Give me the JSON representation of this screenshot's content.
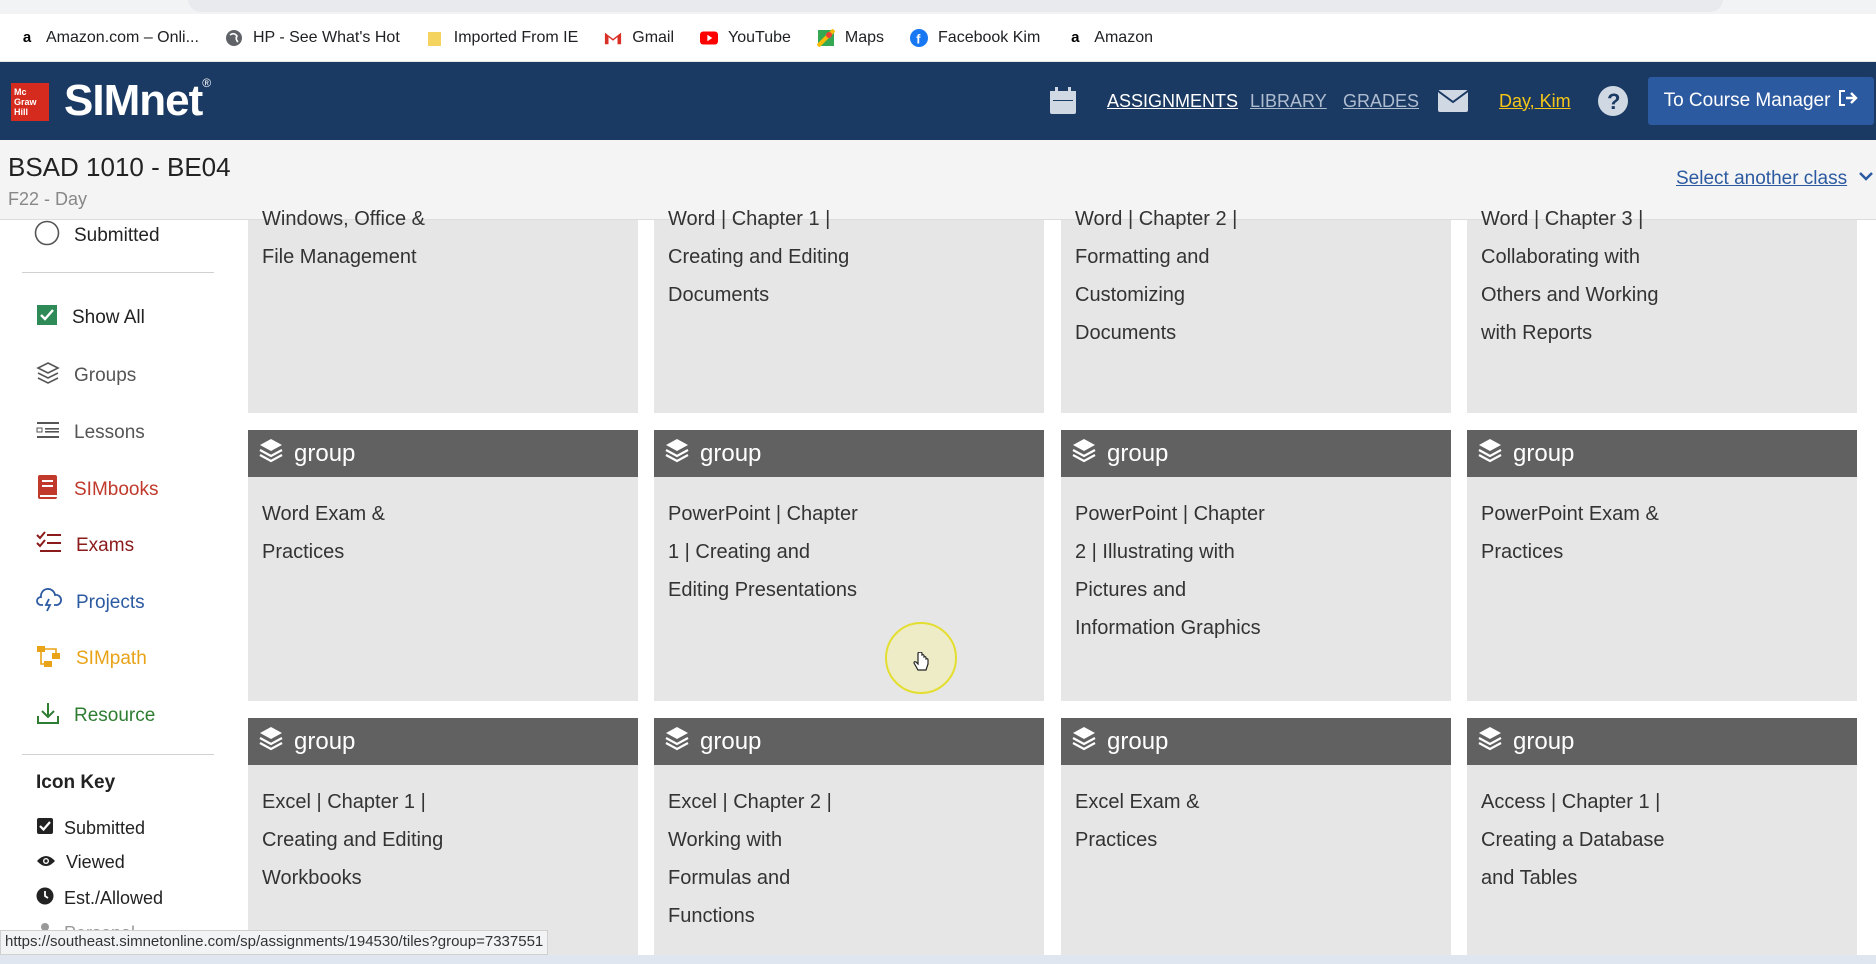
{
  "browser": {
    "url": "southeast.simnetonline.com/sp/assignments/194530/tiles?group=7337543",
    "bookmarks": [
      {
        "label": "Amazon.com – Onli...",
        "icon": "amazon-icon"
      },
      {
        "label": "HP - See What's Hot",
        "icon": "globe-icon"
      },
      {
        "label": "Imported From IE",
        "icon": "folder-icon"
      },
      {
        "label": "Gmail",
        "icon": "gmail-icon"
      },
      {
        "label": "YouTube",
        "icon": "youtube-icon"
      },
      {
        "label": "Maps",
        "icon": "maps-icon"
      },
      {
        "label": "Facebook Kim",
        "icon": "facebook-icon"
      },
      {
        "label": "Amazon",
        "icon": "amazon-icon"
      }
    ]
  },
  "header": {
    "logo_text": "SIMnet",
    "logo_sup": "®",
    "mcgraw": "Mc\nGraw\nHill",
    "nav": {
      "assignments": "ASSIGNMENTS",
      "library": "LIBRARY",
      "grades": "GRADES",
      "user": "Day, Kim"
    },
    "course_manager": "To Course Manager"
  },
  "classbar": {
    "title": "BSAD 1010 - BE04",
    "subtitle": "F22 - Day",
    "select_link": "Select another class"
  },
  "sidebar": {
    "submitted_radio": "Submitted",
    "show_all": "Show All",
    "items": [
      {
        "label": "Groups",
        "color": "#555555",
        "icon": "layers-icon"
      },
      {
        "label": "Lessons",
        "color": "#555555",
        "icon": "lessons-icon"
      },
      {
        "label": "SIMbooks",
        "color": "#c0392b",
        "icon": "book-icon"
      },
      {
        "label": "Exams",
        "color": "#8b1a1a",
        "icon": "exam-list-icon"
      },
      {
        "label": "Projects",
        "color": "#2c5aa0",
        "icon": "cloud-lightning-icon"
      },
      {
        "label": "SIMpath",
        "color": "#e8a317",
        "icon": "path-icon"
      },
      {
        "label": "Resource",
        "color": "#2e7d32",
        "icon": "download-icon"
      }
    ],
    "icon_key_title": "Icon Key",
    "icon_key": [
      {
        "label": "Submitted",
        "icon": "checkbox-icon"
      },
      {
        "label": "Viewed",
        "icon": "eye-icon"
      },
      {
        "label": "Est./Allowed",
        "icon": "clock-icon"
      },
      {
        "label": "Personal",
        "icon": "person-icon"
      }
    ]
  },
  "tiles": {
    "row1": [
      "Windows, Office &\nFile Management",
      "Word | Chapter 1 |\nCreating and Editing\nDocuments",
      "Word | Chapter 2 |\nFormatting and\nCustomizing\nDocuments",
      "Word | Chapter 3 |\nCollaborating with\nOthers and Working\nwith Reports"
    ],
    "group_label": "group",
    "row2": [
      "Word Exam &\nPractices",
      "PowerPoint | Chapter\n1 | Creating and\nEditing Presentations",
      "PowerPoint | Chapter\n2 | Illustrating with\nPictures and\nInformation Graphics",
      "PowerPoint Exam &\nPractices"
    ],
    "row3": [
      "Excel | Chapter 1 |\nCreating and Editing\nWorkbooks",
      "Excel | Chapter 2 |\nWorking with\nFormulas and\nFunctions",
      "Excel Exam &\nPractices",
      "Access | Chapter 1 |\nCreating a Database\nand Tables"
    ]
  },
  "status_url": "https://southeast.simnetonline.com/sp/assignments/194530/tiles?group=7337551"
}
